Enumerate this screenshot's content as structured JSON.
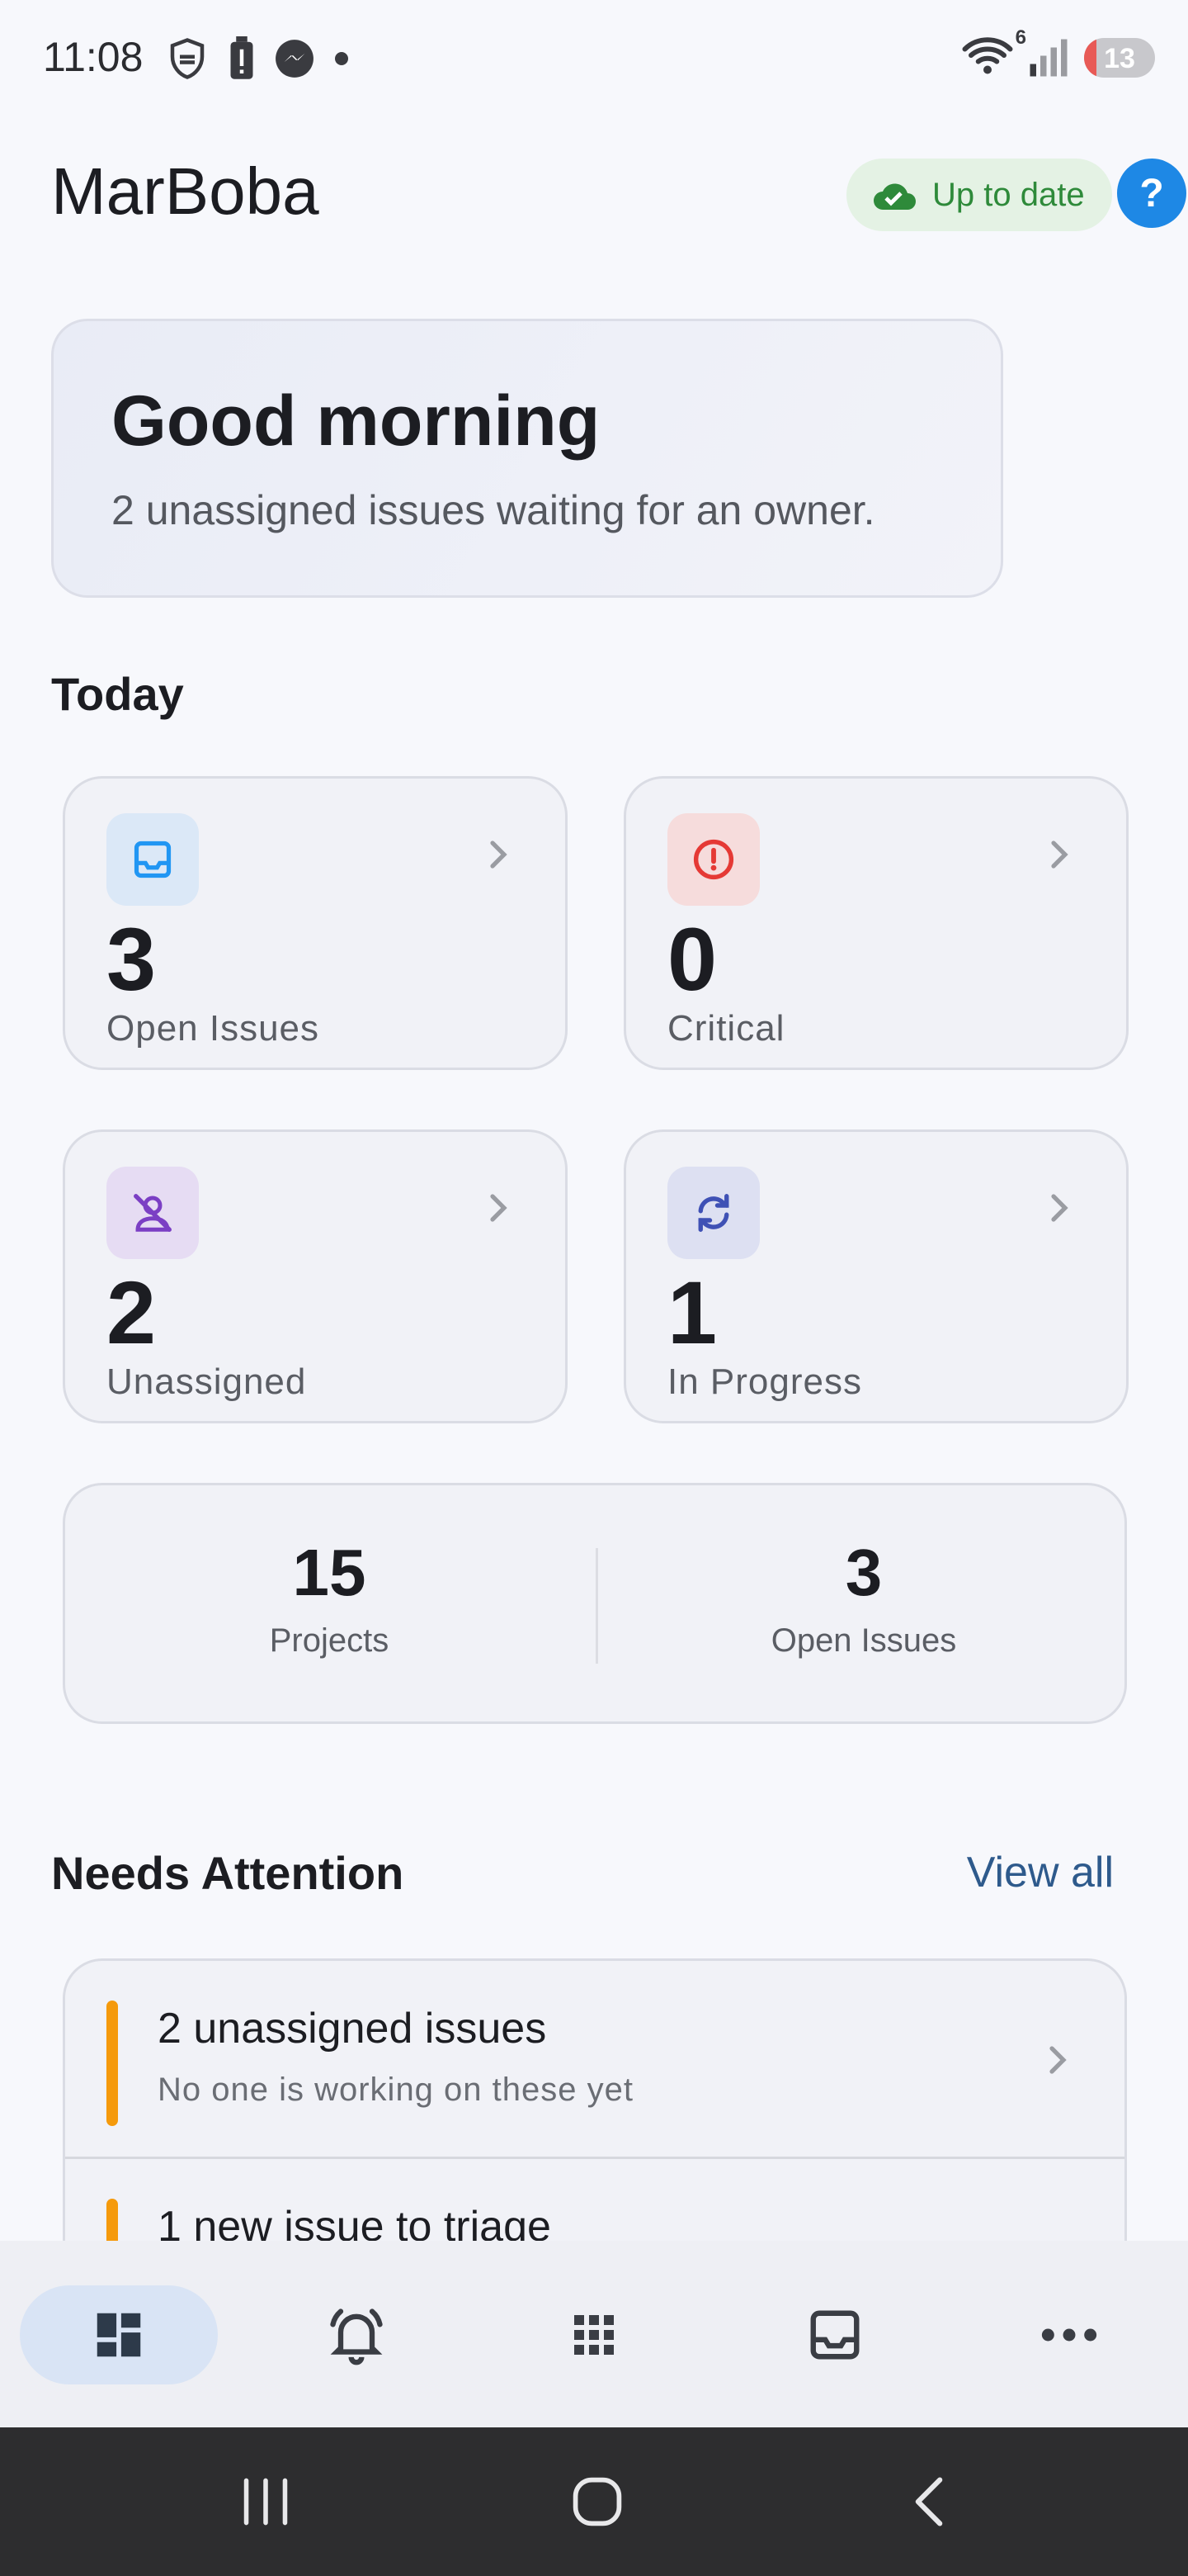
{
  "status_bar": {
    "time": "11:08",
    "battery": "13",
    "wifi_label": "6"
  },
  "header": {
    "title": "MarBoba",
    "sync_status": "Up to date",
    "help_label": "?"
  },
  "greeting": {
    "title": "Good morning",
    "subtitle": "2 unassigned issues waiting for an owner."
  },
  "today": {
    "heading": "Today",
    "cards": [
      {
        "value": "3",
        "label": "Open Issues",
        "icon": "inbox-icon",
        "accent": "#2196f3",
        "icon_bg": "#dbe8f7"
      },
      {
        "value": "0",
        "label": "Critical",
        "icon": "alert-circle-icon",
        "accent": "#e53935",
        "icon_bg": "#f6dcdc"
      },
      {
        "value": "2",
        "label": "Unassigned",
        "icon": "person-off-icon",
        "accent": "#7b3fc4",
        "icon_bg": "#e6dcf3"
      },
      {
        "value": "1",
        "label": "In Progress",
        "icon": "sync-icon",
        "accent": "#3f51b5",
        "icon_bg": "#dde0f2"
      }
    ]
  },
  "summary": {
    "projects_value": "15",
    "projects_label": "Projects",
    "open_value": "3",
    "open_label": "Open Issues"
  },
  "attention": {
    "heading": "Needs Attention",
    "view_all": "View all",
    "items": [
      {
        "title": "2 unassigned issues",
        "subtitle": "No one is working on these yet",
        "accent": "#f59a0c"
      },
      {
        "title": "1 new issue to triage",
        "subtitle": "",
        "accent": "#f59a0c"
      }
    ]
  },
  "bottom_nav": {
    "items": [
      {
        "icon": "dashboard-icon",
        "active": true
      },
      {
        "icon": "notifications-icon",
        "active": false
      },
      {
        "icon": "apps-grid-icon",
        "active": false
      },
      {
        "icon": "inbox-icon",
        "active": false
      },
      {
        "icon": "more-horizontal-icon",
        "active": false
      }
    ]
  },
  "colors": {
    "brand_blue": "#1e88e5",
    "success_green": "#2e8a3a",
    "warning_orange": "#f59a0c"
  }
}
